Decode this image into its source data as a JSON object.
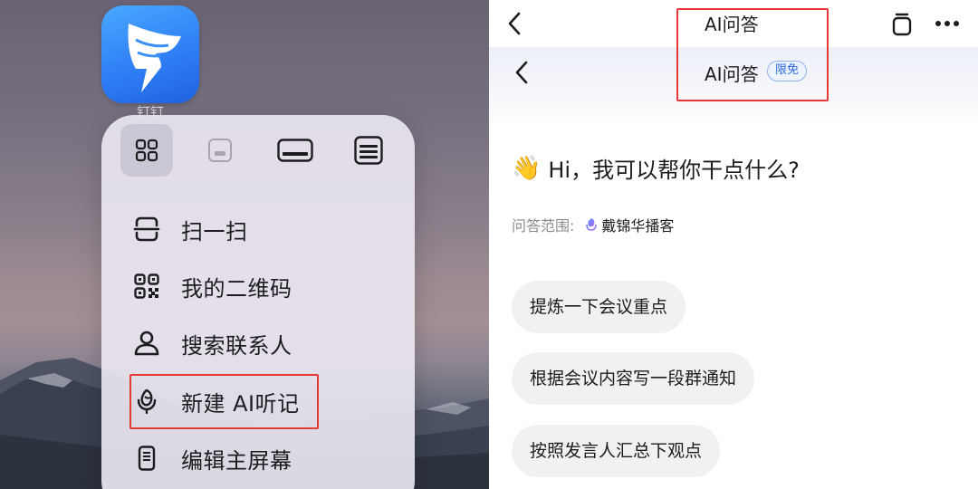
{
  "left": {
    "app_name": "钉钉",
    "widget_buttons": [
      "widget-grid-icon",
      "widget-small-icon",
      "widget-medium-icon",
      "widget-large-icon"
    ],
    "menu_items": [
      {
        "label": "扫一扫",
        "icon": "scan-icon"
      },
      {
        "label": "我的二维码",
        "icon": "qr-code-icon"
      },
      {
        "label": "搜索联系人",
        "icon": "person-icon"
      },
      {
        "label": "新建 AI听记",
        "icon": "ai-mic-icon"
      },
      {
        "label": "编辑主屏幕",
        "icon": "phone-icon"
      }
    ],
    "highlight_color": "#e53935"
  },
  "right": {
    "top_title": "AI问答",
    "sub_title": "AI问答",
    "badge": "限免",
    "greeting_emoji": "👋",
    "greeting": "Hi，我可以帮你干点什么?",
    "scope_label": "问答范围:",
    "scope_source": "戴锦华播客",
    "suggestions": [
      "提炼一下会议重点",
      "根据会议内容写一段群通知",
      "按照发言人汇总下观点"
    ],
    "accent_color": "#2a6ae0"
  }
}
